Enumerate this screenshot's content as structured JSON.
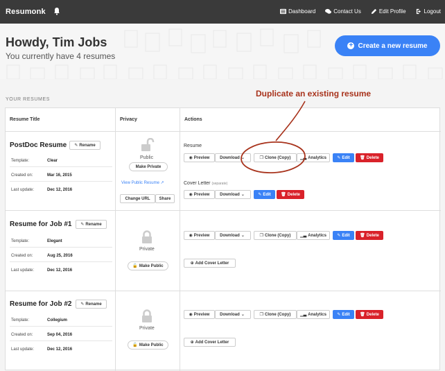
{
  "nav": {
    "brand": "Resumonk",
    "links": [
      {
        "label": "Dashboard",
        "icon": "dashboard-icon"
      },
      {
        "label": "Contact Us",
        "icon": "chat-icon"
      },
      {
        "label": "Edit Profile",
        "icon": "pencil-icon"
      },
      {
        "label": "Logout",
        "icon": "logout-icon"
      }
    ]
  },
  "hero": {
    "greeting": "Howdy, Tim Jobs",
    "subtitle": "You currently have 4 resumes",
    "create_label": "Create a new resume"
  },
  "section_label": "YOUR RESUMES",
  "annotation": "Duplicate an existing resume",
  "table": {
    "headers": [
      "Resume Title",
      "Privacy",
      "Actions"
    ],
    "meta_keys": {
      "template": "Template:",
      "created": "Created on:",
      "updated": "Last update:"
    },
    "labels": {
      "rename": "Rename",
      "preview": "Preview",
      "download": "Download",
      "clone": "Clone (Copy)",
      "analytics": "Analytics",
      "edit": "Edit",
      "delete": "Delete",
      "resume": "Resume",
      "cover_letter": "Cover Letter",
      "separate": "(separate)",
      "add_cover": "Add Cover Letter",
      "public": "Public",
      "private": "Private",
      "make_private": "Make Private",
      "make_public": "Make Public",
      "view_public": "View Public Resume",
      "change_url": "Change URL",
      "share": "Share"
    },
    "rows": [
      {
        "title": "PostDoc Resume",
        "template": "Clear",
        "created": "Mar 16, 2015",
        "updated": "Dec 12, 2016",
        "privacy": "Public"
      },
      {
        "title": "Resume for Job #1",
        "template": "Elegant",
        "created": "Aug 25, 2016",
        "updated": "Dec 12, 2016",
        "privacy": "Private"
      },
      {
        "title": "Resume for Job #2",
        "template": "Collegium",
        "created": "Sep 04, 2016",
        "updated": "Dec 12, 2016",
        "privacy": "Private"
      }
    ]
  },
  "colors": {
    "accent": "#3a82f6",
    "danger": "#d9222a",
    "annotation": "#a8331c",
    "navbar": "#3a3a3a"
  }
}
